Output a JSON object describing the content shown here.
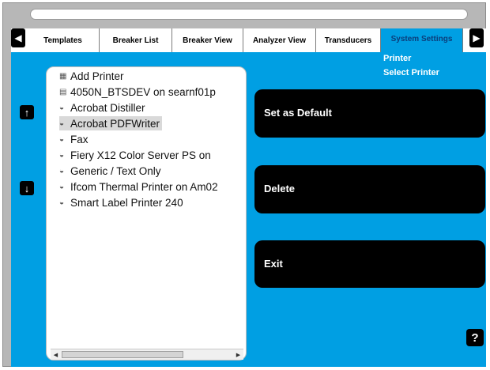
{
  "header": {
    "title_bar_text": ""
  },
  "nav": {
    "prev_icon": "◀",
    "next_icon": "▶"
  },
  "tabs": [
    {
      "label": "Templates"
    },
    {
      "label": "Breaker List"
    },
    {
      "label": "Breaker View"
    },
    {
      "label": "Analyzer View"
    },
    {
      "label": "Transducers"
    },
    {
      "label": "System Settings",
      "active": true
    }
  ],
  "breadcrumb": {
    "section": "Printer",
    "page": "Select Printer"
  },
  "printers": [
    {
      "name": "Add Printer",
      "icon": "add-printer-icon"
    },
    {
      "name": "4050N_BTSDEV on searnf01p",
      "icon": "network-printer-icon"
    },
    {
      "name": "Acrobat Distiller",
      "icon": "printer-icon"
    },
    {
      "name": "Acrobat PDFWriter",
      "icon": "printer-icon",
      "selected": true
    },
    {
      "name": "Fax",
      "icon": "printer-icon"
    },
    {
      "name": "Fiery X12 Color Server PS on",
      "icon": "printer-icon"
    },
    {
      "name": "Generic / Text Only",
      "icon": "printer-icon"
    },
    {
      "name": "Ifcom Thermal Printer on Am02",
      "icon": "printer-icon"
    },
    {
      "name": "Smart Label Printer 240",
      "icon": "printer-icon"
    }
  ],
  "side_buttons": {
    "up_icon": "↑",
    "down_icon": "↓"
  },
  "actions": {
    "set_default_label": "Set as Default",
    "delete_label": "Delete",
    "exit_label": "Exit"
  },
  "help": {
    "label": "?"
  },
  "colors": {
    "accent": "#009fe3",
    "frame": "#b7b7b7",
    "button": "#000000"
  }
}
